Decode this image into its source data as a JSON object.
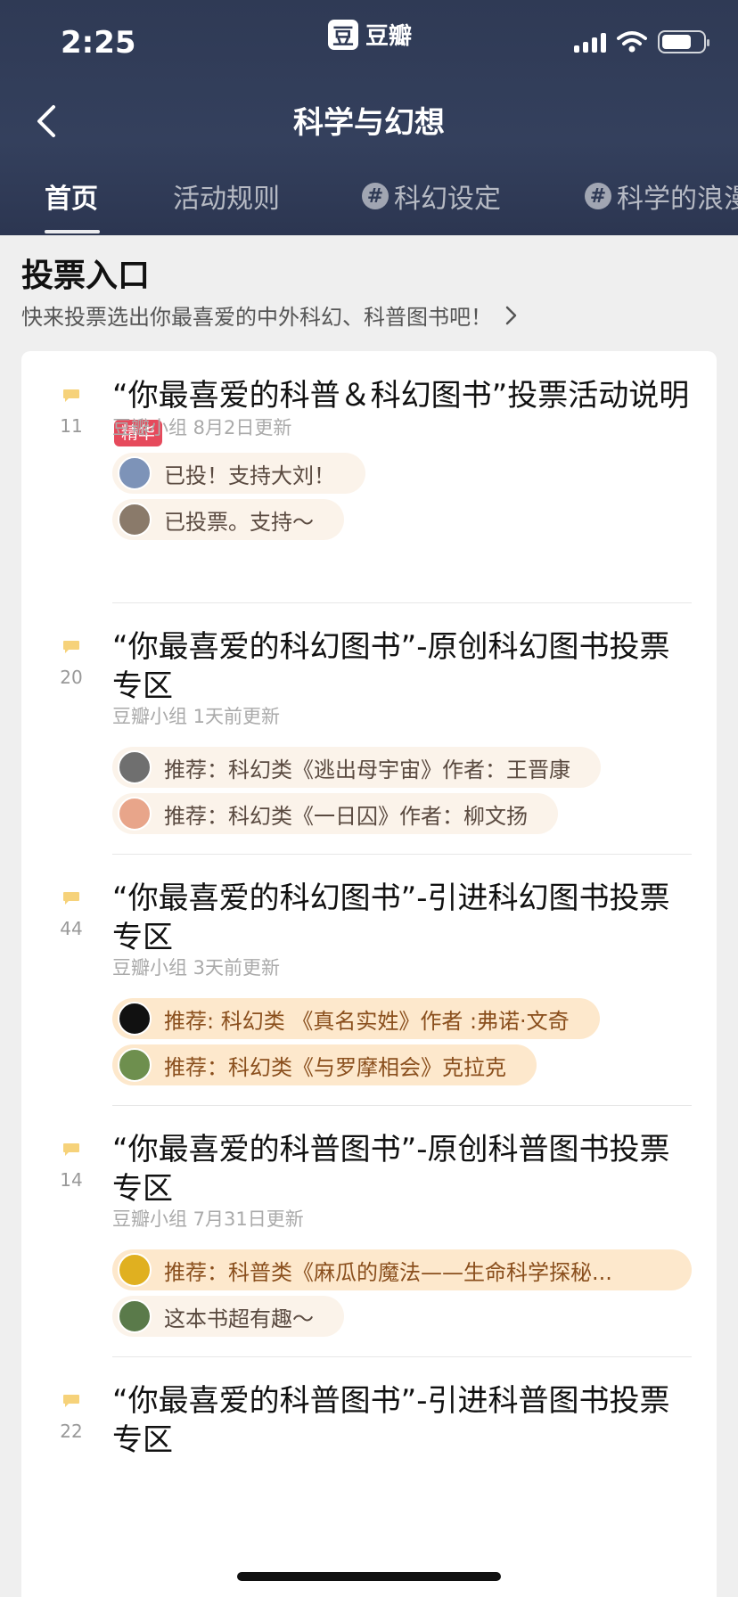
{
  "status_bar": {
    "time": "2:25",
    "app_name": "豆瓣",
    "app_logo": "豆"
  },
  "nav": {
    "title": "科学与幻想"
  },
  "tabs": [
    {
      "label": "首页",
      "active": true
    },
    {
      "label": "活动规则",
      "active": false
    },
    {
      "label": "科幻设定",
      "active": false,
      "icon": "hash-icon"
    },
    {
      "label": "科学的浪漫",
      "active": false,
      "icon": "hash-icon"
    }
  ],
  "vote": {
    "title": "投票入口",
    "subtitle": "快来投票选出你最喜爱的中外科幻、科普图书吧！"
  },
  "posts": [
    {
      "count": "11",
      "title": "“你最喜爱的科普＆科幻图书”投票活动说明",
      "badge": "精华",
      "sub": "豆瓣小组 8月2日更新",
      "comments": [
        {
          "text": "已投！支持大刘！",
          "style": "light",
          "avatar_color": "#7d93b8"
        },
        {
          "text": "已投票。支持～",
          "style": "light",
          "avatar_color": "#8a7a6a"
        }
      ]
    },
    {
      "count": "20",
      "title": "“你最喜爱的科幻图书”-原创科幻图书投票专区",
      "badge": "",
      "sub": "豆瓣小组 1天前更新",
      "comments": [
        {
          "text": "推荐：科幻类《逃出母宇宙》作者：王晋康",
          "style": "light",
          "avatar_color": "#6f6f6f"
        },
        {
          "text": "推荐：科幻类《一日囚》作者：柳文扬",
          "style": "light",
          "avatar_color": "#e8a58a"
        }
      ]
    },
    {
      "count": "44",
      "title": "“你最喜爱的科幻图书”-引进科幻图书投票专区",
      "badge": "",
      "sub": "豆瓣小组 3天前更新",
      "comments": [
        {
          "text": "推荐: 科幻类 《真名实姓》作者 :弗诺·文奇",
          "style": "dark",
          "avatar_color": "#111111"
        },
        {
          "text": "推荐：科幻类《与罗摩相会》克拉克",
          "style": "dark",
          "avatar_color": "#6e8f4e"
        }
      ]
    },
    {
      "count": "14",
      "title": "“你最喜爱的科普图书”-原创科普图书投票专区",
      "badge": "",
      "sub": "豆瓣小组 7月31日更新",
      "comments": [
        {
          "text": "推荐：科普类《麻瓜的魔法——生命科学探秘...",
          "style": "dark",
          "avatar_color": "#e0b020"
        },
        {
          "text": "这本书超有趣～",
          "style": "light",
          "avatar_color": "#5a7a4a"
        }
      ]
    },
    {
      "count": "22",
      "title": "“你最喜爱的科普图书”-引进科普图书投票专区",
      "badge": "",
      "sub": "",
      "comments": []
    }
  ]
}
